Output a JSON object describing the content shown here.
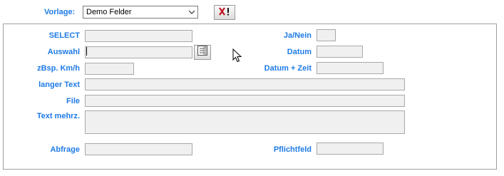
{
  "toolbar": {
    "vorlage_label": "Vorlage:",
    "vorlage_value": "Demo Felder"
  },
  "form": {
    "select_label": "SELECT",
    "auswahl_label": "Auswahl",
    "zbsp_label": "zBsp. Km/h",
    "langer_text_label": "langer Text",
    "file_label": "File",
    "text_mehrz_label": "Text mehrz.",
    "abfrage_label": "Abfrage",
    "janein_label": "Ja/Nein",
    "datum_label": "Datum",
    "datum_zeit_label": "Datum + Zeit",
    "pflichtfeld_label": "Pflichtfeld"
  },
  "icons": {
    "delete_template": "delete-x-icon",
    "picker": "list-picker-icon",
    "dropdown": "chevron-down-icon",
    "cursor": "mouse-pointer-icon"
  },
  "colors": {
    "label": "#1e7be6",
    "field_bg": "#f0f0f0",
    "delete_red": "#c0141e"
  }
}
